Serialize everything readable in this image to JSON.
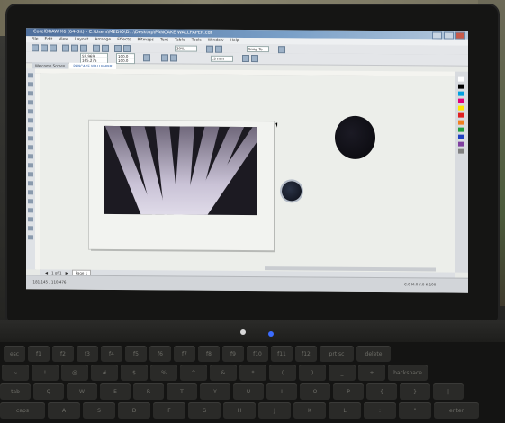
{
  "window": {
    "title": "CorelDRAW X6 (64-Bit) - C:\\Users\\MEDIO\\D...\\Desktop\\PANCAKE WALLPAPER.cdr",
    "controls": [
      "minimize",
      "maximize",
      "close"
    ]
  },
  "menu": [
    "File",
    "Edit",
    "View",
    "Layout",
    "Arrange",
    "Effects",
    "Bitmaps",
    "Text",
    "Table",
    "Tools",
    "Window",
    "Help"
  ],
  "toolbar": {
    "zoom_value": "39%",
    "snap_label": "Snap To",
    "x_value": "59.969 ",
    "y_value": "165.275 ",
    "w_value": "100.0",
    "h_value": "100.0",
    "outline_value": ".5 mm"
  },
  "tabs": [
    "Welcome Screen",
    "PANCAKE WALLPAPER"
  ],
  "page_nav": {
    "count_label": "1 of 1",
    "page_label": "Page 1"
  },
  "status": {
    "left": "(181.145 , 110.476 )",
    "right": "C:0 M:0 Y:0 K:100"
  },
  "colors": {
    "accent": "#4f6f9c",
    "photo_bg": "#1c1a22",
    "ball": "#0d0c12"
  },
  "icons": [
    "pick-tool-icon",
    "shape-tool-icon",
    "zoom-tool-icon",
    "rectangle-tool-icon",
    "ellipse-tool-icon",
    "text-tool-icon",
    "fill-tool-icon",
    "mouse-cursor-icon"
  ],
  "laptop": {
    "brand": "COMPAQ"
  },
  "keyboard": {
    "row1": [
      "esc",
      "f1",
      "f2",
      "f3",
      "f4",
      "f5",
      "f6",
      "f7",
      "f8",
      "f9",
      "f10",
      "f11",
      "f12",
      "prt sc",
      "delete"
    ],
    "row2": [
      "~",
      "!",
      "@",
      "#",
      "$",
      "%",
      "^",
      "&",
      "*",
      "(",
      ")",
      "_",
      "+",
      "backspace"
    ],
    "row3": [
      "tab",
      "Q",
      "W",
      "E",
      "R",
      "T",
      "Y",
      "U",
      "I",
      "O",
      "P",
      "{",
      "}",
      "|"
    ],
    "row4": [
      "caps",
      "A",
      "S",
      "D",
      "F",
      "G",
      "H",
      "J",
      "K",
      "L",
      ":",
      "\"",
      "enter"
    ]
  }
}
